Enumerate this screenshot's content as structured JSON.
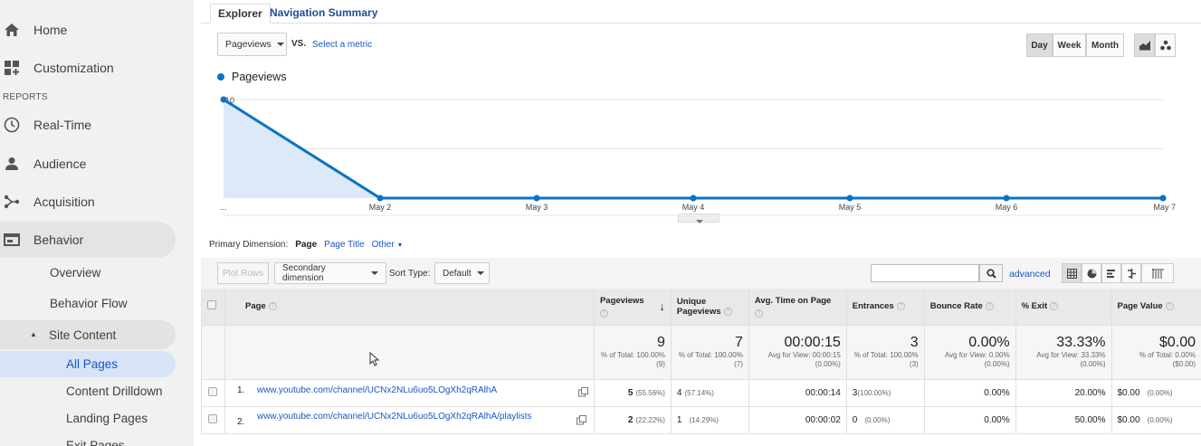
{
  "sidebar": {
    "home": "Home",
    "customization": "Customization",
    "reports_label": "REPORTS",
    "realtime": "Real-Time",
    "audience": "Audience",
    "acquisition": "Acquisition",
    "behavior": "Behavior",
    "overview": "Overview",
    "behavior_flow": "Behavior Flow",
    "site_content": "Site Content",
    "all_pages": "All Pages",
    "content_drilldown": "Content Drilldown",
    "landing_pages": "Landing Pages",
    "exit_pages": "Exit Pages"
  },
  "tabs": {
    "explorer": "Explorer",
    "nav_summary": "Navigation Summary"
  },
  "controls": {
    "metric": "Pageviews",
    "vs": "VS.",
    "select_metric": "Select a metric",
    "day": "Day",
    "week": "Week",
    "month": "Month"
  },
  "chart_data": {
    "type": "area",
    "series": [
      {
        "name": "Pageviews",
        "values": [
          10,
          0,
          0,
          0,
          0,
          0,
          0
        ]
      }
    ],
    "categories": [
      "...",
      "May 2",
      "May 3",
      "May 4",
      "May 5",
      "May 6",
      "May 7"
    ],
    "y_ticks": [
      "10",
      "5"
    ],
    "ylim": [
      0,
      10
    ],
    "grid": true,
    "color": "#0a73c3"
  },
  "dimension": {
    "label": "Primary Dimension:",
    "page": "Page",
    "page_title": "Page Title",
    "other": "Other"
  },
  "toolbar": {
    "plot_rows": "Plot Rows",
    "secondary_dimension": "Secondary dimension",
    "sort_type_label": "Sort Type:",
    "sort_default": "Default",
    "advanced": "advanced"
  },
  "table": {
    "headers": {
      "page": "Page",
      "pageviews": "Pageviews",
      "unique": "Unique Pageviews",
      "avg_time": "Avg. Time on Page",
      "entrances": "Entrances",
      "bounce": "Bounce Rate",
      "exit": "% Exit",
      "value": "Page Value"
    },
    "totals": {
      "pageviews": "9",
      "pageviews_sub": "% of Total: 100.00% (9)",
      "unique": "7",
      "unique_sub": "% of Total: 100.00% (7)",
      "avg_time": "00:00:15",
      "avg_time_sub": "Avg for View: 00:00:15 (0.00%)",
      "entrances": "3",
      "entrances_sub": "% of Total: 100.00% (3)",
      "bounce": "0.00%",
      "bounce_sub": "Avg for View: 0.00% (0.00%)",
      "exit": "33.33%",
      "exit_sub": "Avg for View: 33.33% (0.00%)",
      "value": "$0.00",
      "value_sub": "% of Total: 0.00% ($0.00)"
    },
    "rows": [
      {
        "num": "1.",
        "page": "www.youtube.com/channel/UCNx2NLu6uo5LOgXh2qRAlhA",
        "pageviews": "5",
        "pageviews_pct": "(55.56%)",
        "unique": "4",
        "unique_pct": "(57.14%)",
        "avg_time": "00:00:14",
        "entrances": "3",
        "entrances_pct": "(100.00%)",
        "bounce": "0.00%",
        "exit": "20.00%",
        "value": "$0.00",
        "value_pct": "(0.00%)"
      },
      {
        "num": "2.",
        "page": "www.youtube.com/channel/UCNx2NLu6uo5LOgXh2qRAlhA/playlists",
        "pageviews": "2",
        "pageviews_pct": "(22.22%)",
        "unique": "1",
        "unique_pct": "(14.29%)",
        "avg_time": "00:00:02",
        "entrances": "0",
        "entrances_pct": "(0.00%)",
        "bounce": "0.00%",
        "exit": "50.00%",
        "value": "$0.00",
        "value_pct": "(0.00%)"
      }
    ]
  }
}
